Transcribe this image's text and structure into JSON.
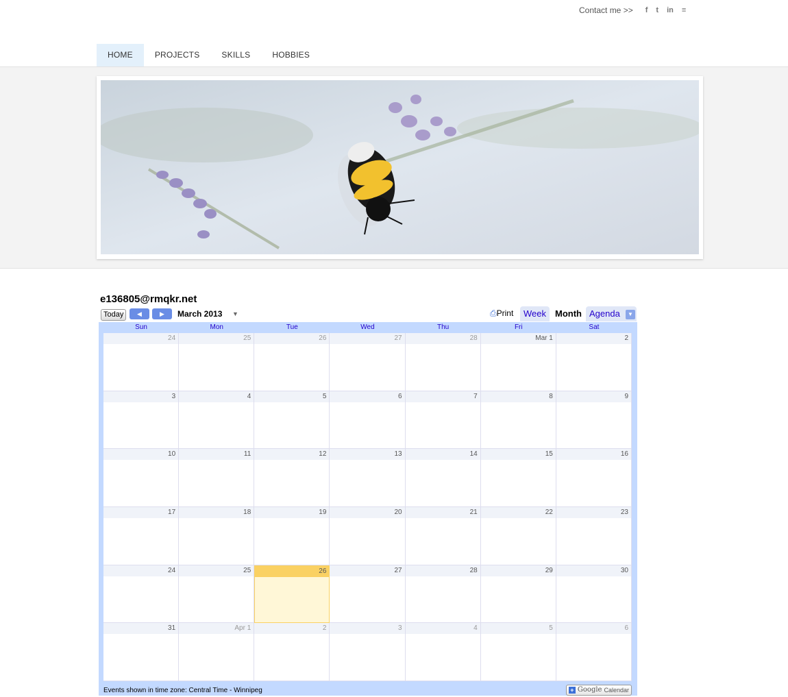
{
  "header": {
    "contact_label": "Contact me >>",
    "social": [
      {
        "icon": "facebook-icon",
        "glyph": "f"
      },
      {
        "icon": "twitter-icon",
        "glyph": "t"
      },
      {
        "icon": "linkedin-icon",
        "glyph": "in"
      },
      {
        "icon": "email-icon",
        "glyph": "≡"
      }
    ]
  },
  "nav": {
    "items": [
      "HOME",
      "PROJECTS",
      "SKILLS",
      "HOBBIES"
    ],
    "active": "HOME"
  },
  "hero": {
    "image": "bee-on-lavender-photo"
  },
  "calendar": {
    "owner": "e136805@rmqkr.net",
    "today_label": "Today",
    "prev_icon": "chevron-left-icon",
    "next_icon": "chevron-right-icon",
    "month_label": "March 2013",
    "print_label": "Print",
    "tabs": [
      "Week",
      "Month",
      "Agenda"
    ],
    "active_tab": "Month",
    "weekdays": [
      "Sun",
      "Mon",
      "Tue",
      "Wed",
      "Thu",
      "Fri",
      "Sat"
    ],
    "weeks": [
      [
        {
          "d": "24",
          "o": true
        },
        {
          "d": "25",
          "o": true
        },
        {
          "d": "26",
          "o": true
        },
        {
          "d": "27",
          "o": true
        },
        {
          "d": "28",
          "o": true
        },
        {
          "d": "Mar 1"
        },
        {
          "d": "2"
        }
      ],
      [
        {
          "d": "3"
        },
        {
          "d": "4"
        },
        {
          "d": "5"
        },
        {
          "d": "6"
        },
        {
          "d": "7"
        },
        {
          "d": "8"
        },
        {
          "d": "9"
        }
      ],
      [
        {
          "d": "10"
        },
        {
          "d": "11"
        },
        {
          "d": "12"
        },
        {
          "d": "13"
        },
        {
          "d": "14"
        },
        {
          "d": "15"
        },
        {
          "d": "16"
        }
      ],
      [
        {
          "d": "17"
        },
        {
          "d": "18"
        },
        {
          "d": "19"
        },
        {
          "d": "20"
        },
        {
          "d": "21"
        },
        {
          "d": "22"
        },
        {
          "d": "23"
        }
      ],
      [
        {
          "d": "24"
        },
        {
          "d": "25"
        },
        {
          "d": "26",
          "today": true
        },
        {
          "d": "27"
        },
        {
          "d": "28"
        },
        {
          "d": "29"
        },
        {
          "d": "30"
        }
      ],
      [
        {
          "d": "31"
        },
        {
          "d": "Apr 1",
          "o": true
        },
        {
          "d": "2",
          "o": true
        },
        {
          "d": "3",
          "o": true
        },
        {
          "d": "4",
          "o": true
        },
        {
          "d": "5",
          "o": true
        },
        {
          "d": "6",
          "o": true
        }
      ]
    ],
    "footer_timezone": "Events shown in time zone: Central Time - Winnipeg",
    "gcal_brand": "Google",
    "gcal_label": "Calendar",
    "colors": {
      "today": "#fad163",
      "accent": "#c3d9ff",
      "link": "#2200cc"
    }
  }
}
